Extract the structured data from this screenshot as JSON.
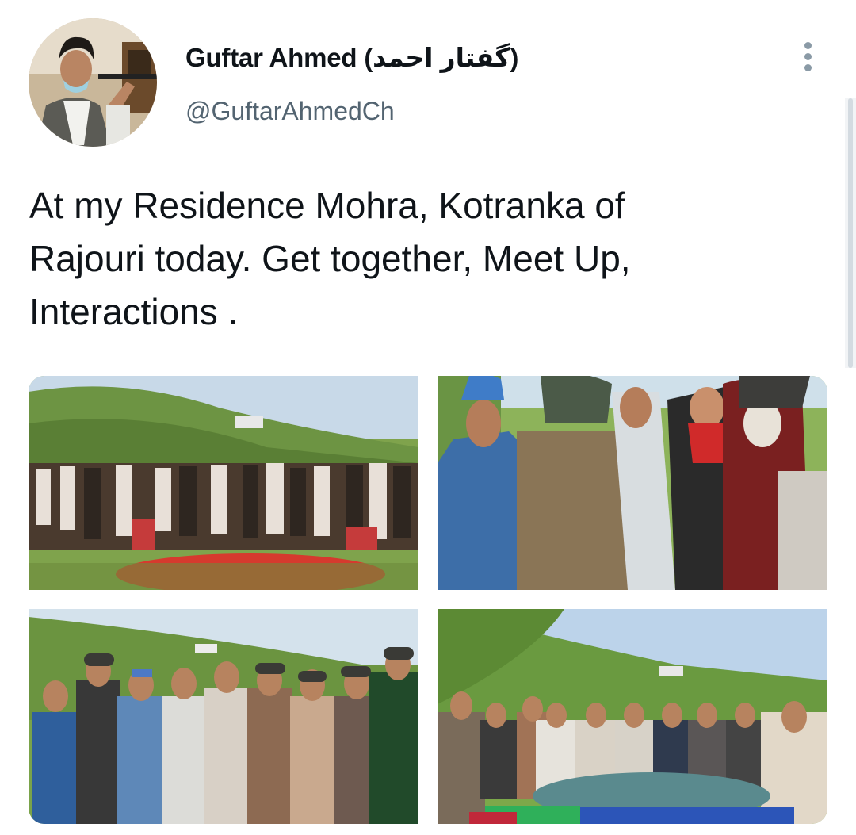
{
  "tweet": {
    "author": {
      "display_name": "Guftar Ahmed (گفتار احمد)",
      "handle": "@GuftarAhmedCh",
      "avatar_icon": "profile-photo"
    },
    "more_icon": "more-vertical-icon",
    "text": "At my Residence Mohra, Kotranka of Rajouri today. Get together, Meet Up, Interactions .",
    "media": [
      {
        "name": "group-photo-seated-gathering",
        "icon": "photo"
      },
      {
        "name": "photo-elders-greeting",
        "icon": "photo"
      },
      {
        "name": "photo-standing-group",
        "icon": "photo"
      },
      {
        "name": "photo-seated-circle",
        "icon": "photo"
      }
    ]
  },
  "colors": {
    "text": "#0f1419",
    "secondary": "#536471",
    "more_dots": "#8a9aa6",
    "background": "#ffffff"
  }
}
